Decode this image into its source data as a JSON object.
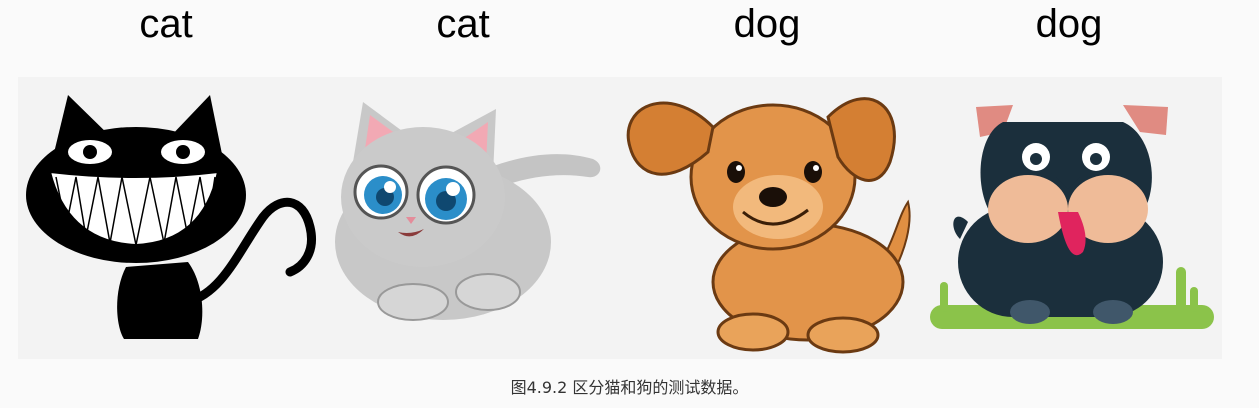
{
  "labels": [
    "cat",
    "cat",
    "dog",
    "dog"
  ],
  "caption": "图4.9.2 区分猫和狗的测试数据。",
  "images": [
    {
      "name": "black-grinning-cat-illustration",
      "icon": "black-cat"
    },
    {
      "name": "gray-kitten-illustration",
      "icon": "gray-kitten"
    },
    {
      "name": "orange-puppy-illustration",
      "icon": "orange-puppy"
    },
    {
      "name": "dark-bulldog-illustration",
      "icon": "dark-bulldog"
    }
  ],
  "colors": {
    "background": "#fafafa",
    "strip": "#f3f3f3",
    "grass": "#8bc34a",
    "bulldog": "#1b2f3c",
    "puppy": "#e2944a",
    "kitten": "#c8c8c8"
  }
}
